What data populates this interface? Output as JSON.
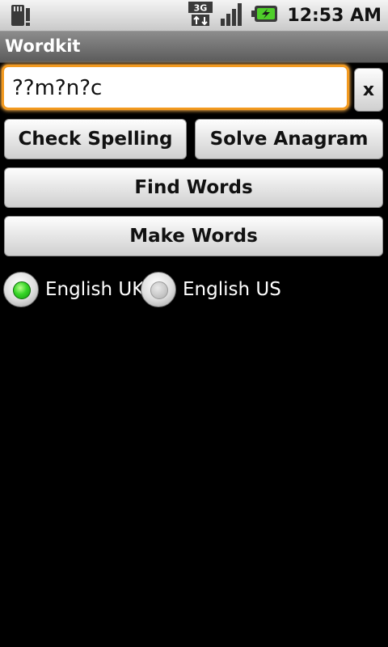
{
  "status_bar": {
    "time": "12:53 AM",
    "network": "3G",
    "icons": [
      "sd-card-icon",
      "network-3g-icon",
      "signal-icon",
      "battery-charging-icon"
    ]
  },
  "app": {
    "title": "Wordkit"
  },
  "search": {
    "value": "??m?n?c",
    "clear_label": "x"
  },
  "buttons": {
    "check_spelling": "Check Spelling",
    "solve_anagram": "Solve Anagram",
    "find_words": "Find Words",
    "make_words": "Make Words"
  },
  "dictionary": {
    "options": [
      {
        "label": "English UK",
        "selected": true
      },
      {
        "label": "English US",
        "selected": false
      }
    ]
  },
  "colors": {
    "accent_focus": "#f39a1f",
    "radio_selected": "#38d629"
  }
}
